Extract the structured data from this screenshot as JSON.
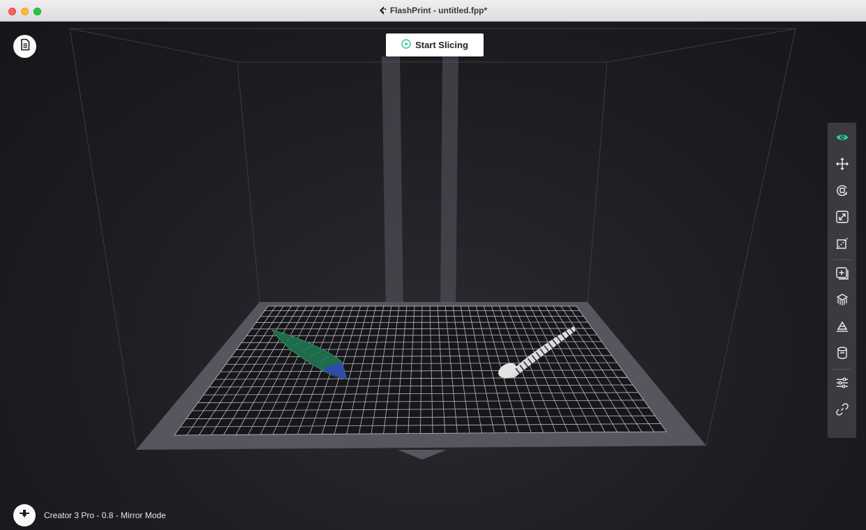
{
  "window": {
    "title": "FlashPrint - untitled.fpp*",
    "app_icon": "flashprint-logo-icon"
  },
  "top": {
    "start_slicing_label": "Start Slicing",
    "start_icon": "play-circle-icon",
    "file_icon": "document-icon"
  },
  "toolbar": {
    "items": [
      {
        "name": "view",
        "icon": "eye-icon",
        "active": true
      },
      {
        "name": "move",
        "icon": "move-arrows-icon"
      },
      {
        "name": "rotate",
        "icon": "rotate-icon"
      },
      {
        "name": "scale",
        "icon": "scale-icon"
      },
      {
        "name": "cut",
        "icon": "cut-icon"
      },
      {
        "name": "add-model",
        "icon": "add-box-icon"
      },
      {
        "name": "supports",
        "icon": "supports-icon"
      },
      {
        "name": "lay-flat",
        "icon": "lay-flat-icon"
      },
      {
        "name": "cylinder",
        "icon": "cylinder-icon"
      },
      {
        "name": "settings",
        "icon": "sliders-icon"
      },
      {
        "name": "link",
        "icon": "link-icon"
      }
    ],
    "accent_color": "#2ecc8f"
  },
  "status": {
    "printer_icon": "extruder-icon",
    "text": "Creator 3 Pro - 0.8 - Mirror Mode"
  },
  "colors": {
    "background": "#1b1b1f",
    "platform": "#5a5a63",
    "grid": "#ffffff",
    "model_left": "#1f6b4a",
    "model_right": "#e6e6e6"
  }
}
